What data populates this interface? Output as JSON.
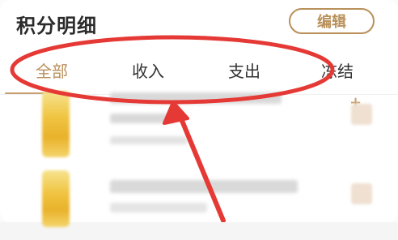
{
  "header": {
    "title": "积分明细",
    "edit_label": "编辑"
  },
  "tabs": [
    {
      "label": "全部",
      "active": true
    },
    {
      "label": "收入",
      "active": false
    },
    {
      "label": "支出",
      "active": false
    },
    {
      "label": "冻结",
      "active": false
    }
  ],
  "theme": {
    "accent": "#b9905a",
    "annotation_red": "#e53935"
  },
  "list": {
    "rows": [
      {
        "thumbnail": "blurred",
        "sign": "+"
      },
      {
        "thumbnail": "blurred"
      }
    ]
  }
}
